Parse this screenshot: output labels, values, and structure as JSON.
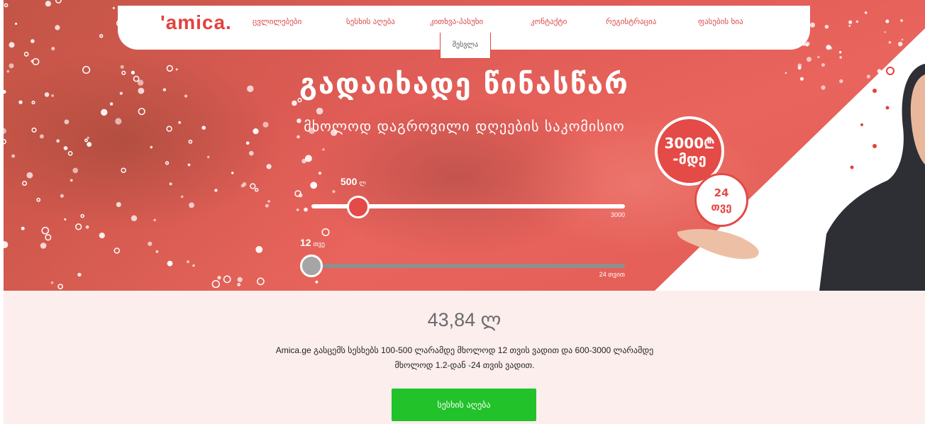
{
  "header": {
    "logo": "'amica.",
    "nav": [
      "ცვლილებები",
      "სესხის აღება",
      "კითხვა-პასუხი",
      "კონტაქტი",
      "რეგისტრაცია",
      "ფასების ხია"
    ],
    "login": "შესვლა"
  },
  "hero": {
    "title": "გადაიხადე წინასწარ",
    "subtitle": "მხოლოდ დაგროვილი დღეების საკომისიო",
    "badge_amount_line1": "3000₾",
    "badge_amount_line2": "-მდე",
    "badge_term_line1": "24",
    "badge_term_line2": "თვე"
  },
  "amount_slider": {
    "value": "500",
    "unit": "ლ",
    "max": "3000",
    "fraction": 0.15
  },
  "term_slider": {
    "value": "12",
    "unit": "თვე",
    "max": "24 თვით",
    "fraction": 0.0
  },
  "result": {
    "payment": "43,84 ლ",
    "description": "Amica.ge გასცემს სესხებს 100-500 ლარამდე მხოლოდ 12 თვის ვადით და 600-3000 ლარამდე მხოლოდ 1.2-დან -24 თვის ვადით."
  },
  "cta": {
    "label": "სესხის აღება"
  },
  "colors": {
    "brand": "#e3423f",
    "cta": "#22c22a",
    "page_bg": "#fdeeee"
  }
}
